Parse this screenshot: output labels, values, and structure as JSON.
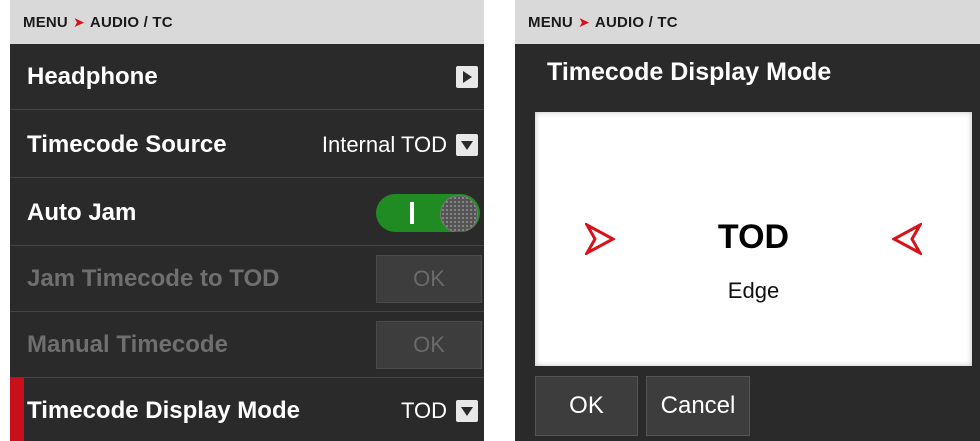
{
  "left": {
    "breadcrumb": {
      "root": "MENU",
      "separator": "➤",
      "section": "AUDIO / TC"
    },
    "rows": [
      {
        "label": "Headphone"
      },
      {
        "label": "Timecode Source",
        "value": "Internal TOD"
      },
      {
        "label": "Auto Jam",
        "toggle_on": true
      },
      {
        "label": "Jam Timecode to TOD",
        "button": "OK",
        "disabled": true
      },
      {
        "label": "Manual Timecode",
        "button": "OK",
        "disabled": true
      },
      {
        "label": "Timecode Display Mode",
        "value": "TOD",
        "selected": true
      }
    ]
  },
  "right": {
    "breadcrumb": {
      "root": "MENU",
      "separator": "➤",
      "section": "AUDIO / TC"
    },
    "title": "Timecode Display Mode",
    "picker": {
      "current": "TOD",
      "next": "Edge"
    },
    "buttons": {
      "ok": "OK",
      "cancel": "Cancel"
    }
  },
  "colors": {
    "panel_bg": "#2a2a2a",
    "breadcrumb_bg": "#d9d9d9",
    "accent_red": "#d8121b",
    "toggle_green": "#1f8b22"
  },
  "icons": [
    "chevron-right-icon",
    "chevron-down-icon",
    "arrow-left-icon",
    "arrow-right-icon"
  ]
}
